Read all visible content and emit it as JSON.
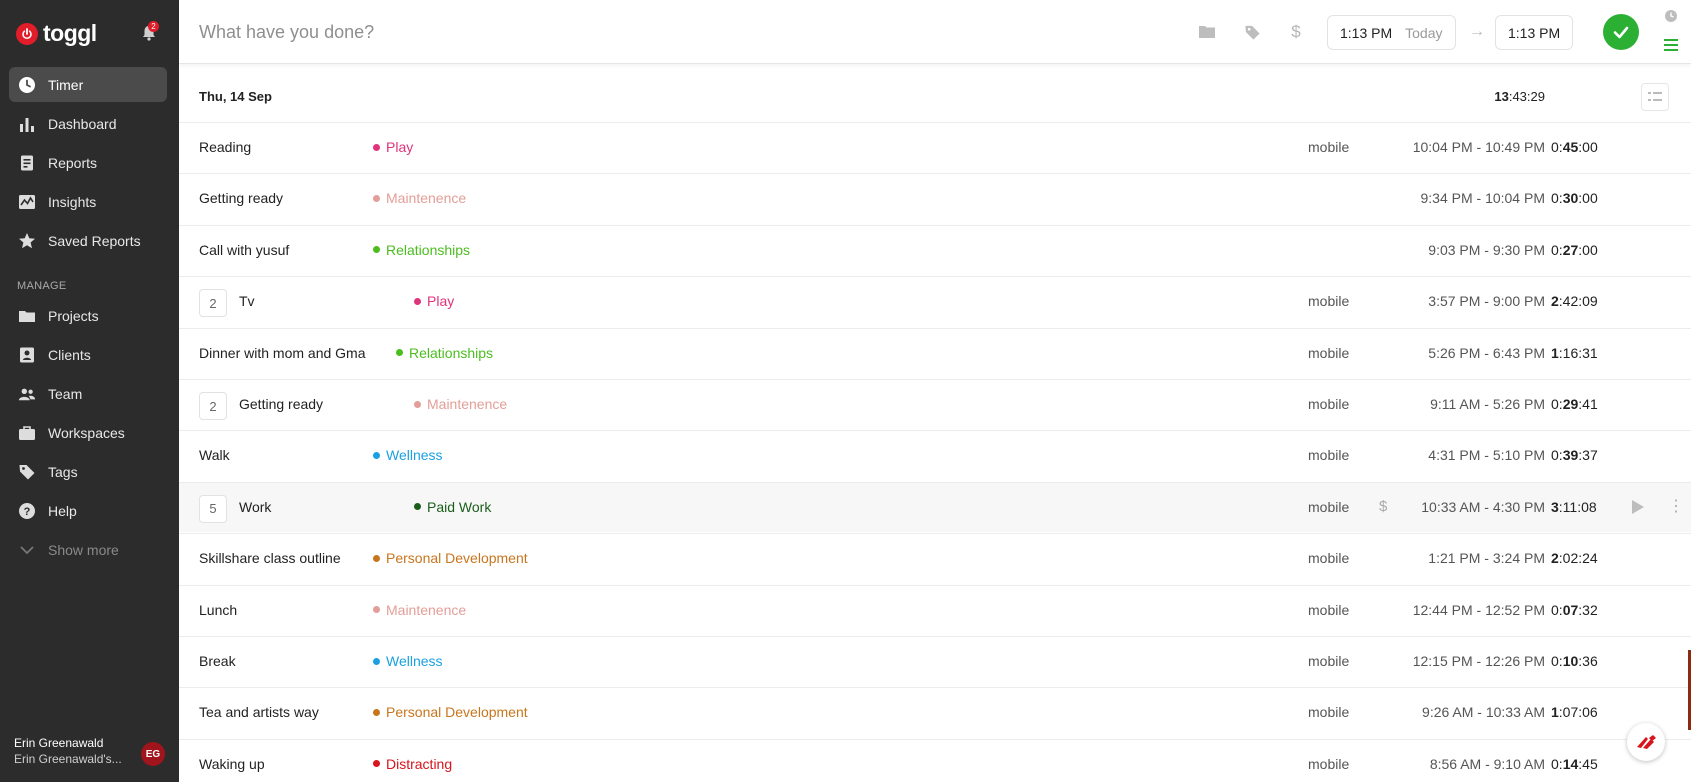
{
  "app": {
    "logo_text": "toggl",
    "notification_count": "2"
  },
  "sidebar": {
    "items": [
      {
        "label": "Timer",
        "icon": "clock-icon"
      },
      {
        "label": "Dashboard",
        "icon": "bar-chart-icon"
      },
      {
        "label": "Reports",
        "icon": "report-icon"
      },
      {
        "label": "Insights",
        "icon": "insights-icon"
      },
      {
        "label": "Saved Reports",
        "icon": "star-icon"
      }
    ],
    "manage_label": "MANAGE",
    "manage_items": [
      {
        "label": "Projects",
        "icon": "folder-icon"
      },
      {
        "label": "Clients",
        "icon": "client-icon"
      },
      {
        "label": "Team",
        "icon": "team-icon"
      },
      {
        "label": "Workspaces",
        "icon": "briefcase-icon"
      },
      {
        "label": "Tags",
        "icon": "tag-icon"
      },
      {
        "label": "Help",
        "icon": "help-icon"
      },
      {
        "label": "Show more",
        "icon": "chevron-down-icon"
      }
    ],
    "user": {
      "name": "Erin Greenawald",
      "workspace": "Erin Greenawald's...",
      "initials": "EG"
    }
  },
  "topbar": {
    "description_placeholder": "What have you done?",
    "start_time": "1:13 PM",
    "start_day": "Today",
    "end_time": "1:13 PM",
    "accent": "#2cb034"
  },
  "day": {
    "title": "Thu, 14 Sep",
    "total_prefix": "13",
    "total_rest": ":43:29"
  },
  "entries": [
    {
      "group": "",
      "desc": "Reading",
      "project": "Play",
      "color": "#e0337b",
      "tag": "mobile",
      "range": "10:04 PM - 10:49 PM",
      "dur_a": "0:",
      "dur_b": "45",
      "dur_c": ":00"
    },
    {
      "group": "",
      "desc": "Getting ready",
      "project": "Maintenence",
      "color": "#e39e98",
      "tag": "",
      "range": "9:34 PM - 10:04 PM",
      "dur_a": "0:",
      "dur_b": "30",
      "dur_c": ":00"
    },
    {
      "group": "",
      "desc": "Call with yusuf",
      "project": "Relationships",
      "color": "#4bbe1e",
      "tag": "",
      "range": "9:03 PM - 9:30 PM",
      "dur_a": "0:",
      "dur_b": "27",
      "dur_c": ":00"
    },
    {
      "group": "2",
      "desc": "Tv",
      "project": "Play",
      "color": "#e0337b",
      "tag": "mobile",
      "range": "3:57 PM - 9:00 PM",
      "dur_a": "2",
      "dur_b": "",
      "dur_c": ":42:09"
    },
    {
      "group": "",
      "desc": "Dinner with mom and Gma",
      "project": "Relationships",
      "color": "#4bbe1e",
      "tag": "mobile",
      "range": "5:26 PM - 6:43 PM",
      "dur_a": "1",
      "dur_b": "",
      "dur_c": ":16:31"
    },
    {
      "group": "2",
      "desc": "Getting ready",
      "project": "Maintenence",
      "color": "#e39e98",
      "tag": "mobile",
      "range": "9:11 AM - 5:26 PM",
      "dur_a": "0:",
      "dur_b": "29",
      "dur_c": ":41"
    },
    {
      "group": "",
      "desc": "Walk",
      "project": "Wellness",
      "color": "#1ba1e2",
      "tag": "mobile",
      "range": "4:31 PM - 5:10 PM",
      "dur_a": "0:",
      "dur_b": "39",
      "dur_c": ":37"
    },
    {
      "group": "5",
      "desc": "Work",
      "project": "Paid Work",
      "color": "#1b5e1b",
      "tag": "mobile",
      "range": "10:33 AM - 4:30 PM",
      "dur_a": "3",
      "dur_b": "",
      "dur_c": ":11:08",
      "billable": true,
      "hover": true
    },
    {
      "group": "",
      "desc": "Skillshare class outline",
      "project": "Personal Development",
      "color": "#c8761e",
      "tag": "mobile",
      "range": "1:21 PM - 3:24 PM",
      "dur_a": "2",
      "dur_b": "",
      "dur_c": ":02:24"
    },
    {
      "group": "",
      "desc": "Lunch",
      "project": "Maintenence",
      "color": "#e39e98",
      "tag": "mobile",
      "range": "12:44 PM - 12:52 PM",
      "dur_a": "0:",
      "dur_b": "07",
      "dur_c": ":32"
    },
    {
      "group": "",
      "desc": "Break",
      "project": "Wellness",
      "color": "#1ba1e2",
      "tag": "mobile",
      "range": "12:15 PM - 12:26 PM",
      "dur_a": "0:",
      "dur_b": "10",
      "dur_c": ":36"
    },
    {
      "group": "",
      "desc": "Tea and artists way",
      "project": "Personal Development",
      "color": "#c8761e",
      "tag": "mobile",
      "range": "9:26 AM - 10:33 AM",
      "dur_a": "1",
      "dur_b": "",
      "dur_c": ":07:06"
    },
    {
      "group": "",
      "desc": "Waking up",
      "project": "Distracting",
      "color": "#d8141c",
      "tag": "mobile",
      "range": "8:56 AM - 9:10 AM",
      "dur_a": "0:",
      "dur_b": "14",
      "dur_c": ":45"
    }
  ]
}
